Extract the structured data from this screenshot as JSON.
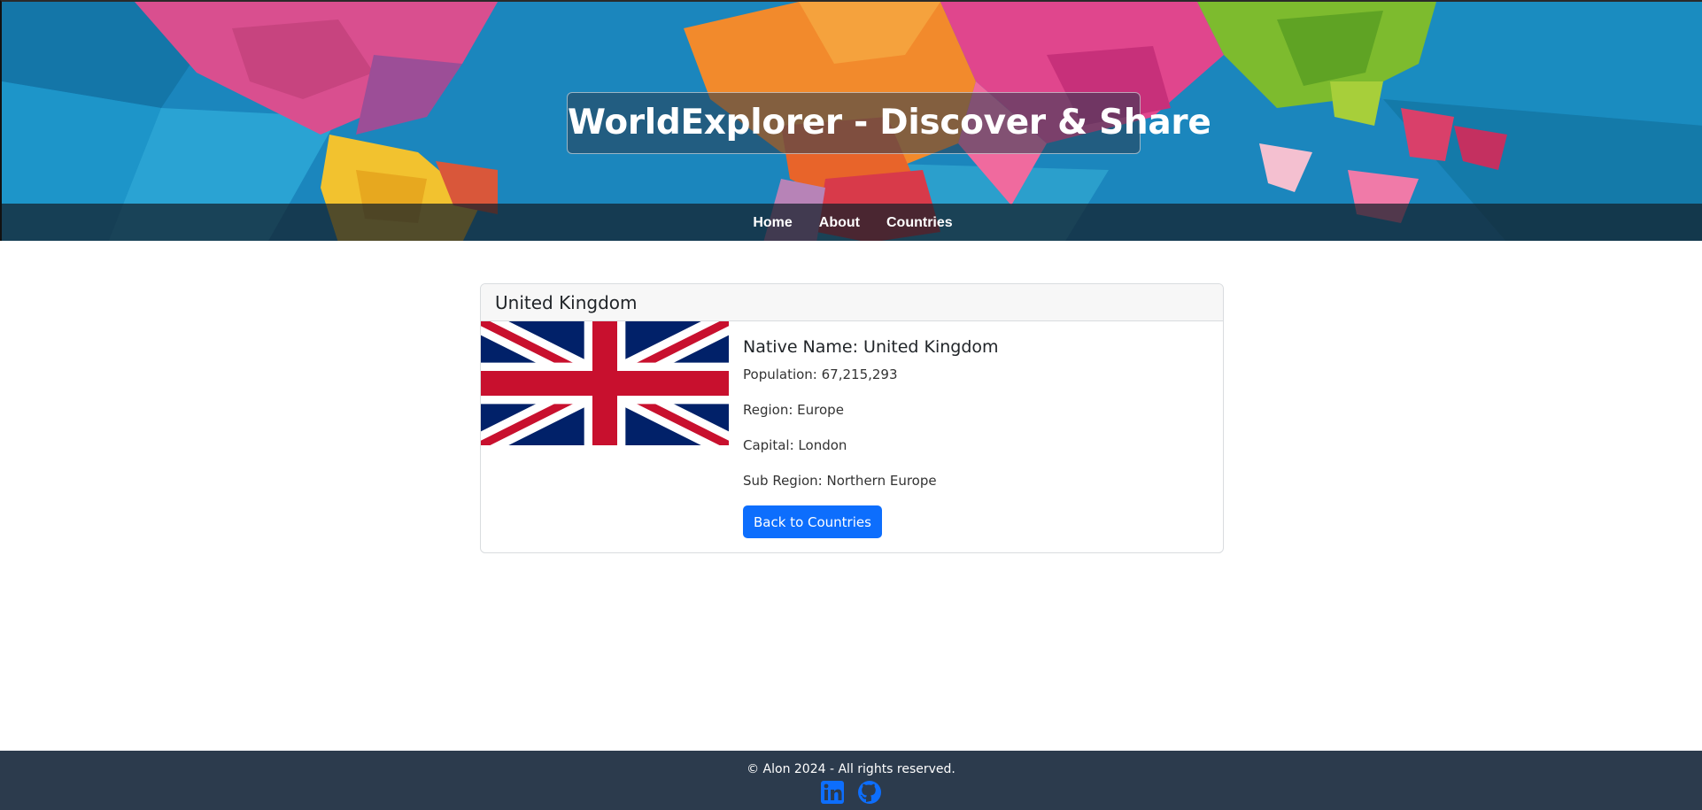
{
  "header": {
    "title": "WorldExplorer - Discover & Share"
  },
  "nav": {
    "items": [
      {
        "label": "Home"
      },
      {
        "label": "About"
      },
      {
        "label": "Countries"
      }
    ]
  },
  "country": {
    "name": "United Kingdom",
    "native_name_label": "Native Name: United Kingdom",
    "population": "Population: 67,215,293",
    "region": "Region: Europe",
    "capital": "Capital: London",
    "subregion": "Sub Region: Northern Europe",
    "back_button": "Back to Countries",
    "flag": "union-jack"
  },
  "footer": {
    "copyright": "© Alon 2024 - All rights reserved.",
    "icons": [
      "linkedin-icon",
      "github-icon"
    ],
    "icon_color": "#0d6efd"
  },
  "colors": {
    "accent": "#0d6efd",
    "footer_bg": "#2c3b4d"
  }
}
